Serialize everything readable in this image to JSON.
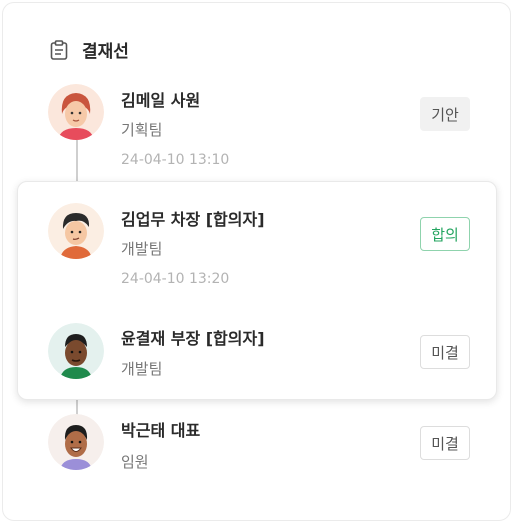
{
  "panel": {
    "title": "결재선",
    "icon": "clipboard-icon"
  },
  "approvers": [
    {
      "name": "김메일 사원",
      "dept": "기획팀",
      "time": "24-04-10 13:10",
      "status": "기안"
    },
    {
      "name": "김업무 차장 [합의자]",
      "dept": "개발팀",
      "time": "24-04-10 13:20",
      "status": "합의"
    },
    {
      "name": "윤결재 부장 [합의자]",
      "dept": "개발팀",
      "status": "미결"
    },
    {
      "name": "박근태 대표",
      "dept": "임원",
      "status": "미결"
    }
  ],
  "colors": {
    "agree": "#24a560",
    "agree_border": "#8fd3ad",
    "draft_bg": "#f1f1f1"
  }
}
